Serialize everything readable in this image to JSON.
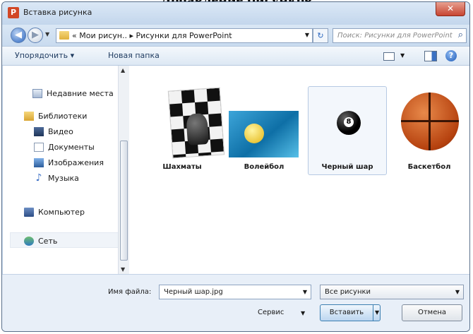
{
  "heading": "Добавление рисунков",
  "window": {
    "title": "Вставка рисунка",
    "app_icon": "P",
    "close_glyph": "✕"
  },
  "nav": {
    "back_glyph": "◀",
    "forward_glyph": "▶",
    "history_glyph": "▼",
    "address": "« Мои рисун.. ▸ Рисунки для PowerPoint",
    "address_drop_glyph": "▼",
    "refresh_glyph": "↻",
    "search_placeholder": "Поиск: Рисунки для PowerPoint",
    "search_glyph": "⌕"
  },
  "toolbar": {
    "organize_label": "Упорядочить ▾",
    "new_folder_label": "Новая папка",
    "view_drop_glyph": "▼",
    "help_glyph": "?"
  },
  "sidebar": {
    "items": [
      {
        "label": "Недавние места",
        "icon": "recent-places-icon"
      },
      {
        "label": "Библиотеки",
        "icon": "libraries-icon"
      },
      {
        "label": "Видео",
        "icon": "video-icon"
      },
      {
        "label": "Документы",
        "icon": "documents-icon"
      },
      {
        "label": "Изображения",
        "icon": "images-icon"
      },
      {
        "label": "Музыка",
        "icon": "music-icon"
      },
      {
        "label": "Компьютер",
        "icon": "computer-icon"
      },
      {
        "label": "Сеть",
        "icon": "network-icon"
      }
    ],
    "scroll_up_glyph": "▲",
    "scroll_down_glyph": "▼"
  },
  "files": [
    {
      "name": "Шахматы",
      "icon": "chess-thumbnail"
    },
    {
      "name": "Волейбол",
      "icon": "volleyball-thumbnail"
    },
    {
      "name": "Черный шар",
      "icon": "black-ball-thumbnail",
      "selected": true
    },
    {
      "name": "Баскетбол",
      "icon": "basketball-thumbnail"
    }
  ],
  "footer": {
    "filename_label": "Имя файла:",
    "filename_value": "Черный шар.jpg",
    "filter_value": "Все рисунки",
    "service_label": "Сервис",
    "insert_label": "Вставить",
    "cancel_label": "Отмена",
    "drop_glyph": "▼",
    "eight": "8"
  }
}
